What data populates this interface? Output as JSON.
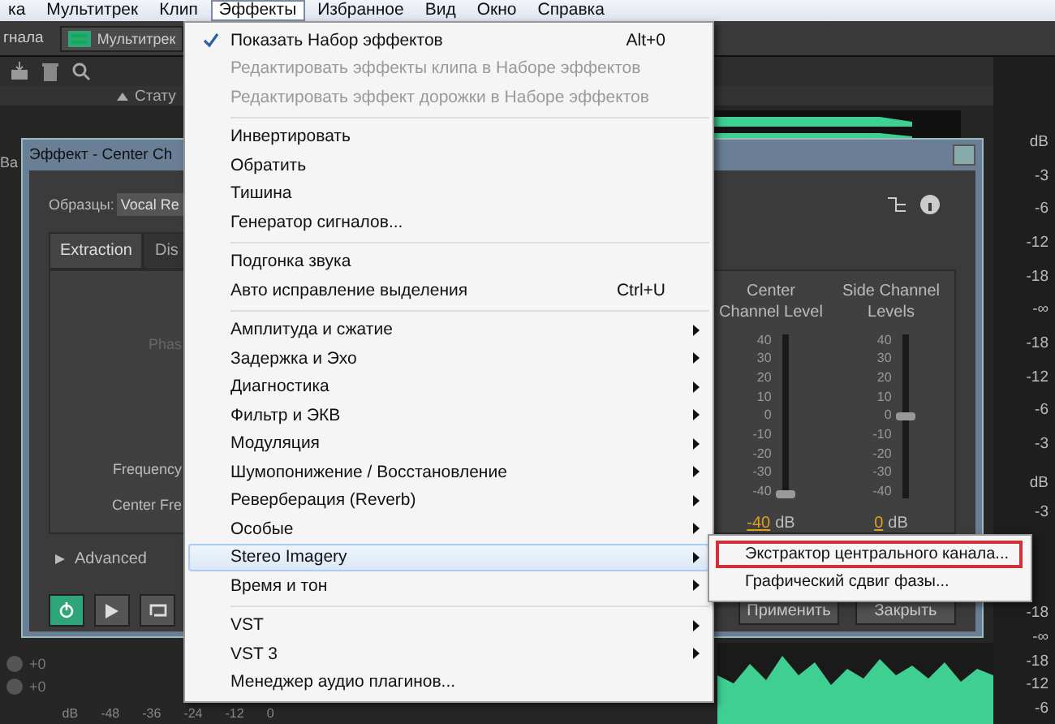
{
  "menubar": [
    {
      "label": "ка",
      "selected": false
    },
    {
      "label": "Мультитрек",
      "selected": false
    },
    {
      "label": "Клип",
      "selected": false
    },
    {
      "label": "Эффекты",
      "selected": true
    },
    {
      "label": "Избранное",
      "selected": false
    },
    {
      "label": "Вид",
      "selected": false
    },
    {
      "label": "Окно",
      "selected": false
    },
    {
      "label": "Справка",
      "selected": false
    }
  ],
  "toolbar": {
    "tab_1": "гнала",
    "tab_2": "Мультитрек"
  },
  "panel_header": "Стату",
  "left_fragment": "Ва",
  "dialog": {
    "title": "Эффект - Center Ch",
    "presets_label": "Образцы:",
    "preset_value": "Vocal Re",
    "tabs": [
      {
        "label": "Extraction",
        "selected": true
      },
      {
        "label": "Dis",
        "selected": false
      }
    ],
    "phase_label": "Phas",
    "frequency_label": "Frequency",
    "center_freq_label": "Center Fre",
    "advanced": {
      "label": "Advanced",
      "expanded": false
    },
    "sliders": [
      {
        "label": "Center Channel Level",
        "ticks": [
          "40",
          "30",
          "20",
          "10",
          "0",
          "-10",
          "-20",
          "-30",
          "-40"
        ],
        "level": 0,
        "value": "-40",
        "unit": "dB"
      },
      {
        "label": "Side Channel Levels",
        "ticks": [
          "40",
          "30",
          "20",
          "10",
          "0",
          "-10",
          "-20",
          "-30",
          "-40"
        ],
        "level": 0.5,
        "value": "0",
        "unit": "dB"
      }
    ],
    "power": {
      "on": true
    },
    "buttons": [
      "Применить",
      "Закрыть"
    ]
  },
  "meter_scale": [
    "dB",
    "-3",
    "-6",
    "-12",
    "-18",
    "-∞",
    "-18",
    "-12",
    "-6",
    "-3",
    "dB",
    "-3",
    "-18",
    "-∞",
    "-18",
    "-12",
    "-6"
  ],
  "track_knobs": [
    "+0",
    "+0"
  ],
  "level_ruler": [
    "dB",
    "-48",
    "-36",
    "-24",
    "-12",
    "0"
  ],
  "menu": [
    {
      "kind": "item",
      "label": "Показать Набор эффектов",
      "shortcut": "Alt+0",
      "checked": true,
      "disabled": false,
      "submenu": false,
      "selected": false
    },
    {
      "kind": "item",
      "label": "Редактировать эффекты клипа в Наборе эффектов",
      "checked": false,
      "disabled": true,
      "submenu": false,
      "selected": false
    },
    {
      "kind": "item",
      "label": "Редактировать эффект дорожки в Наборе эффектов",
      "checked": false,
      "disabled": true,
      "submenu": false,
      "selected": false
    },
    {
      "kind": "separator"
    },
    {
      "kind": "item",
      "label": "Инвертировать",
      "checked": false,
      "disabled": false,
      "submenu": false,
      "selected": false
    },
    {
      "kind": "item",
      "label": "Обратить",
      "checked": false,
      "disabled": false,
      "submenu": false,
      "selected": false
    },
    {
      "kind": "item",
      "label": "Тишина",
      "checked": false,
      "disabled": false,
      "submenu": false,
      "selected": false
    },
    {
      "kind": "item",
      "label": "Генератор сигналов...",
      "checked": false,
      "disabled": false,
      "submenu": false,
      "selected": false
    },
    {
      "kind": "separator"
    },
    {
      "kind": "item",
      "label": "Подгонка звука",
      "checked": false,
      "disabled": false,
      "submenu": false,
      "selected": false
    },
    {
      "kind": "item",
      "label": "Авто исправление выделения",
      "shortcut": "Ctrl+U",
      "checked": false,
      "disabled": false,
      "submenu": false,
      "selected": false
    },
    {
      "kind": "separator"
    },
    {
      "kind": "item",
      "label": "Амплитуда и сжатие",
      "checked": false,
      "disabled": false,
      "submenu": true,
      "selected": false
    },
    {
      "kind": "item",
      "label": "Задержка и Эхо",
      "checked": false,
      "disabled": false,
      "submenu": true,
      "selected": false
    },
    {
      "kind": "item",
      "label": "Диагностика",
      "checked": false,
      "disabled": false,
      "submenu": true,
      "selected": false
    },
    {
      "kind": "item",
      "label": "Фильтр и ЭКВ",
      "checked": false,
      "disabled": false,
      "submenu": true,
      "selected": false
    },
    {
      "kind": "item",
      "label": "Модуляция",
      "checked": false,
      "disabled": false,
      "submenu": true,
      "selected": false
    },
    {
      "kind": "item",
      "label": "Шумопонижение / Восстановление",
      "checked": false,
      "disabled": false,
      "submenu": true,
      "selected": false
    },
    {
      "kind": "item",
      "label": "Реверберация (Reverb)",
      "checked": false,
      "disabled": false,
      "submenu": true,
      "selected": false
    },
    {
      "kind": "item",
      "label": "Особые",
      "checked": false,
      "disabled": false,
      "submenu": true,
      "selected": false
    },
    {
      "kind": "item",
      "label": "Stereo Imagery",
      "checked": false,
      "disabled": false,
      "submenu": true,
      "selected": true
    },
    {
      "kind": "item",
      "label": "Время и тон",
      "checked": false,
      "disabled": false,
      "submenu": true,
      "selected": false
    },
    {
      "kind": "separator"
    },
    {
      "kind": "item",
      "label": "VST",
      "checked": false,
      "disabled": false,
      "submenu": true,
      "selected": false
    },
    {
      "kind": "item",
      "label": "VST 3",
      "checked": false,
      "disabled": false,
      "submenu": true,
      "selected": false
    },
    {
      "kind": "item",
      "label": "Менеджер аудио плагинов...",
      "checked": false,
      "disabled": false,
      "submenu": false,
      "selected": false
    }
  ],
  "submenu": [
    {
      "label": "Экстрактор центрального канала...",
      "outlined": true
    },
    {
      "label": "Графический сдвиг фазы...",
      "outlined": false
    }
  ]
}
